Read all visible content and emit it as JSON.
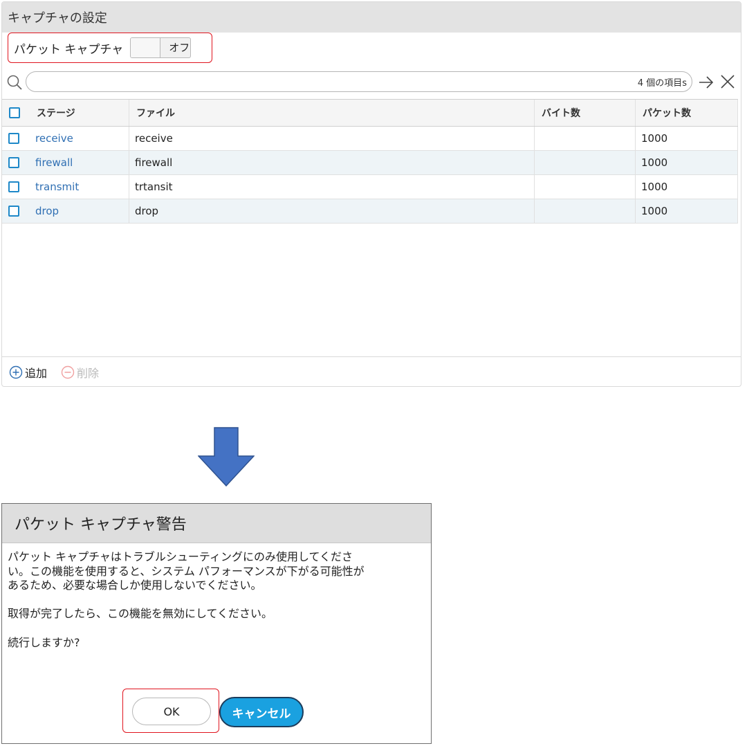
{
  "settings_panel": {
    "title": "キャプチャの設定",
    "packet_capture_label": "パケット キャプチャ",
    "toggle_state": "オフ",
    "search": {
      "placeholder": "",
      "value": "",
      "count_text": "4 個の項目s"
    },
    "columns": [
      "ステージ",
      "ファイル",
      "バイト数",
      "パケット数"
    ],
    "rows": [
      {
        "stage": "receive",
        "file": "receive",
        "bytes": "",
        "packets": "1000"
      },
      {
        "stage": "firewall",
        "file": "firewall",
        "bytes": "",
        "packets": "1000"
      },
      {
        "stage": "transmit",
        "file": "trtansit",
        "bytes": "",
        "packets": "1000"
      },
      {
        "stage": "drop",
        "file": "drop",
        "bytes": "",
        "packets": "1000"
      }
    ],
    "add_label": "追加",
    "delete_label": "削除"
  },
  "dialog": {
    "title": "パケット キャプチャ警告",
    "message_lines": [
      "パケット キャプチャはトラブルシューティングにのみ使用してくださ",
      "い。この機能を使用すると、システム パフォーマンスが下がる可能性が",
      "あるため、必要な場合しか使用しないでください。"
    ],
    "message_2": "取得が完了したら、この機能を無効にしてください。",
    "question": "続行しますか?",
    "ok_label": "OK",
    "cancel_label": "キャンセル"
  },
  "colors": {
    "highlight": "#e0141e",
    "link": "#2f6fb3",
    "arrow": "#4472c4",
    "cancel_button": "#1aa1e0"
  }
}
